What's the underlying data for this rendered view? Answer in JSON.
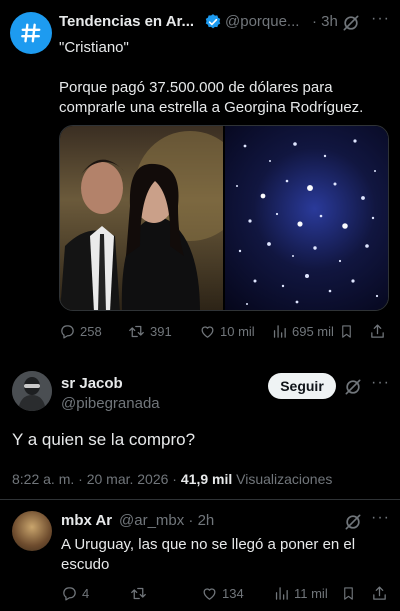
{
  "top_tweet": {
    "name": "Tendencias en Ar...",
    "handle": "@porque...",
    "time": "· 3h",
    "subtitle": "\"Cristiano\"",
    "text": "Porque pagó 37.500.000 de dólares para comprarle una estrella a Georgina Rodríguez.",
    "stats": {
      "replies": "258",
      "reposts": "391",
      "likes": "10 mil",
      "views": "695 mil"
    }
  },
  "reply_main": {
    "name": "sr Jacob",
    "handle": "@pibegranada",
    "follow_label": "Seguir",
    "text": "Y a quien se la compro?",
    "datetime": "8:22 a. m. · 20 mar. 2026 ·",
    "views_count": "41,9 mil",
    "views_label": "Visualizaciones"
  },
  "reply_second": {
    "name": "mbx Ar",
    "handle": "@ar_mbx · 2h",
    "text": "A Uruguay, las que no se llegó a poner en el escudo",
    "stats": {
      "replies": "4",
      "reposts": "",
      "likes": "134",
      "views": "11 mil"
    }
  },
  "colors": {
    "accent": "#1d9bf0",
    "muted": "#71767b",
    "text": "#e7e9ea",
    "background": "#000000"
  },
  "icons": [
    "hash-icon",
    "verified-icon",
    "grok-icon",
    "more-icon",
    "reply-icon",
    "repost-icon",
    "like-icon",
    "views-icon",
    "bookmark-icon",
    "share-icon"
  ]
}
